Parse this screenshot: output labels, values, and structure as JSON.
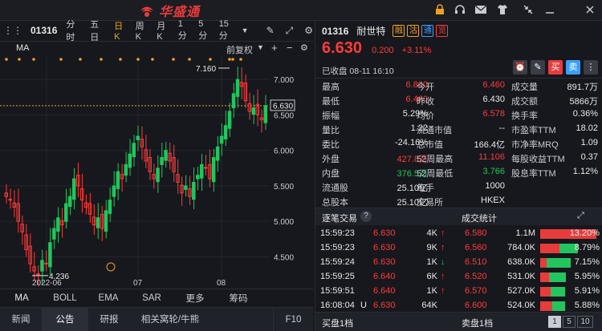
{
  "topbar": {
    "brand": "华盛通",
    "icons": [
      "lock-icon",
      "headset-icon",
      "mail-icon",
      "shirt-icon",
      "collapse-icon",
      "minimize-icon",
      "close-icon"
    ]
  },
  "chart_toolbar": {
    "code": "01316",
    "periods": [
      "分时",
      "五日",
      "日K",
      "周K",
      "月K",
      "1分",
      "5分",
      "15分"
    ],
    "active_period": "日K",
    "ma_label": "MA",
    "adjust_label": "前复权"
  },
  "chart": {
    "high_label": "7.160",
    "low_label": "4.236",
    "last_price_tag": "6.630",
    "y_ticks": [
      "7.000",
      "6.500",
      "6.000",
      "5.500",
      "5.000",
      "4.500"
    ],
    "x_ticks": [
      "2022-06",
      "07",
      "08"
    ],
    "colors": {
      "up": "#22c55e",
      "down": "#ff3b3b",
      "bg": "#16181d"
    }
  },
  "chart_data": {
    "type": "candlestick",
    "y_ticks": [
      7.0,
      6.5,
      6.0,
      5.5,
      5.0,
      4.5
    ],
    "ylim": [
      4.2,
      7.25
    ],
    "high": 7.16,
    "low": 4.236,
    "last": 6.63
  },
  "indicator_tabs": [
    "MA",
    "BOLL",
    "EMA",
    "SAR",
    "更多",
    "筹码"
  ],
  "bottom_tabs": [
    "新闻",
    "公告",
    "研报",
    "相关窝轮/牛熊",
    "F10"
  ],
  "active_bottom_tab": "公告",
  "quote": {
    "code": "01316",
    "name": "耐世特",
    "badges": [
      "融",
      "沽",
      "通",
      "览"
    ],
    "price": "6.630",
    "change": "0.200",
    "change_pct": "+3.11%",
    "status": "已收盘 08-11 16:10",
    "action_buttons": [
      "alert-icon",
      "edit-icon",
      "买",
      "卖",
      "more-icon"
    ],
    "rows": [
      [
        {
          "l": "最高",
          "v": "6.800",
          "c": "red"
        },
        {
          "l": "今开",
          "v": "6.460",
          "c": "red"
        },
        {
          "l": "成交量",
          "v": "891.7万",
          "c": "white"
        }
      ],
      [
        {
          "l": "最低",
          "v": "6.460",
          "c": "red"
        },
        {
          "l": "昨收",
          "v": "6.430",
          "c": "white"
        },
        {
          "l": "成交额",
          "v": "5866万",
          "c": "white"
        }
      ],
      [
        {
          "l": "振幅",
          "v": "5.29%",
          "c": "white"
        },
        {
          "l": "均价",
          "v": "6.578",
          "c": "red"
        },
        {
          "l": "换手率",
          "v": "0.36%",
          "c": "white"
        }
      ],
      [
        {
          "l": "量比",
          "v": "1.22",
          "c": "white"
        },
        {
          "l": "流通市值",
          "v": "--",
          "c": "white"
        },
        {
          "l": "市盈率TTM",
          "v": "18.02",
          "c": "white"
        }
      ],
      [
        {
          "l": "委比",
          "v": "-24.16%",
          "c": "white"
        },
        {
          "l": "总市值",
          "v": "166.4亿",
          "c": "white"
        },
        {
          "l": "市净率MRQ",
          "v": "1.09",
          "c": "white"
        }
      ],
      [
        {
          "l": "外盘",
          "v": "427.8万",
          "c": "red"
        },
        {
          "l": "52周最高",
          "v": "11.106",
          "c": "red"
        },
        {
          "l": "每股收益TTM",
          "v": "0.37",
          "c": "white"
        }
      ],
      [
        {
          "l": "内盘",
          "v": "376.5万",
          "c": "green"
        },
        {
          "l": "52周最低",
          "v": "3.766",
          "c": "green"
        },
        {
          "l": "股息率TTM",
          "v": "1.12%",
          "c": "white"
        }
      ],
      [
        {
          "l": "流通股",
          "v": "25.10亿",
          "c": "white"
        },
        {
          "l": "每手",
          "v": "1000",
          "c": "white"
        },
        {
          "l": "",
          "v": "",
          "c": "white"
        }
      ],
      [
        {
          "l": "总股本",
          "v": "25.10亿",
          "c": "white"
        },
        {
          "l": "交易所",
          "v": "HKEX",
          "c": "white"
        },
        {
          "l": "",
          "v": "",
          "c": "white"
        }
      ]
    ]
  },
  "trades": {
    "title": "逐笔交易",
    "items": [
      {
        "t": "15:59:23",
        "flag": "",
        "p": "6.630",
        "q": "4K",
        "dir": "up"
      },
      {
        "t": "15:59:23",
        "flag": "",
        "p": "6.630",
        "q": "9K",
        "dir": "up"
      },
      {
        "t": "15:59:24",
        "flag": "",
        "p": "6.630",
        "q": "1K",
        "dir": "down"
      },
      {
        "t": "15:59:25",
        "flag": "",
        "p": "6.640",
        "q": "6K",
        "dir": "up"
      },
      {
        "t": "15:59:51",
        "flag": "",
        "p": "6.640",
        "q": "1K",
        "dir": "up"
      },
      {
        "t": "16:08:04",
        "flag": "U",
        "p": "6.630",
        "q": "64K",
        "dir": "none"
      }
    ]
  },
  "volume_stats": {
    "title": "成交统计",
    "items": [
      {
        "p": "6.580",
        "v": "1.1M",
        "pct": "13.20%",
        "r": 0.132,
        "g": 0.0
      },
      {
        "p": "6.560",
        "v": "784.0K",
        "pct": "8.79%",
        "r": 0.045,
        "g": 0.043
      },
      {
        "p": "6.510",
        "v": "638.0K",
        "pct": "7.15%",
        "r": 0.015,
        "g": 0.057
      },
      {
        "p": "6.520",
        "v": "531.0K",
        "pct": "5.95%",
        "r": 0.02,
        "g": 0.04
      },
      {
        "p": "6.570",
        "v": "527.0K",
        "pct": "5.91%",
        "r": 0.025,
        "g": 0.034
      },
      {
        "p": "6.600",
        "v": "524.0K",
        "pct": "5.88%",
        "r": 0.028,
        "g": 0.031
      }
    ]
  },
  "bottom_bar": {
    "buy_label": "买盘1档",
    "sell_label": "卖盘1档",
    "levels": [
      "1",
      "5",
      "10"
    ]
  }
}
